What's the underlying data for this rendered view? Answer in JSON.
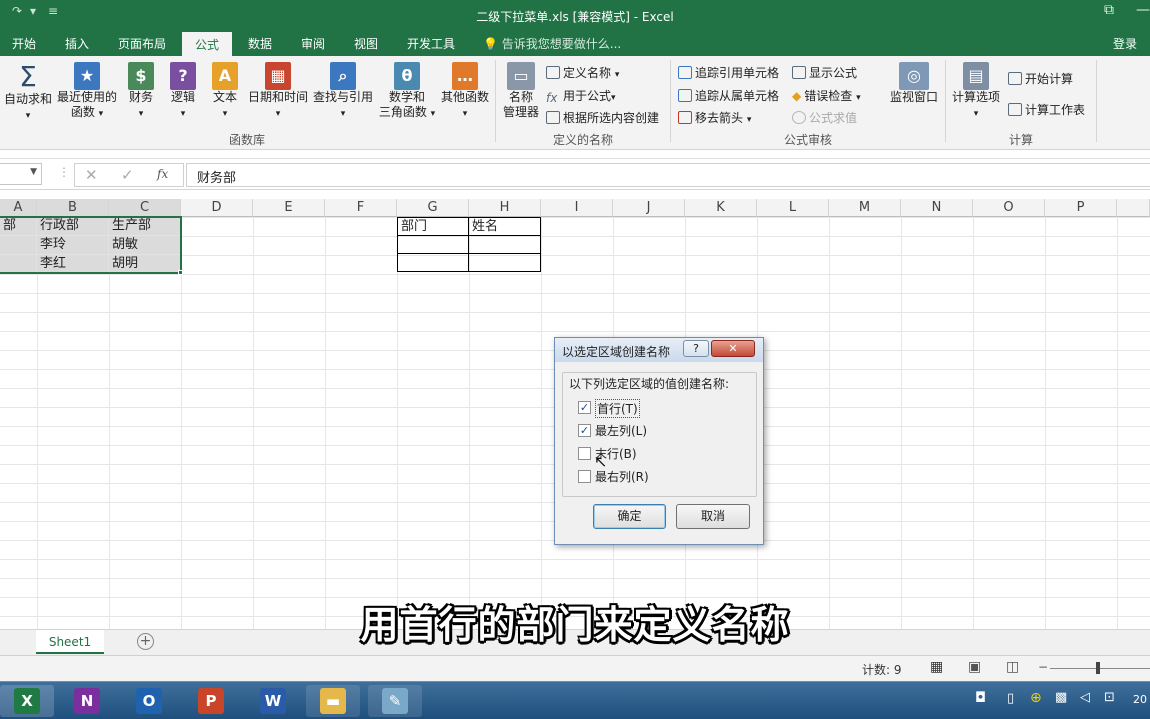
{
  "window": {
    "title": "二级下拉菜单.xls  [兼容模式] - Excel"
  },
  "tabs": [
    {
      "label": "开始"
    },
    {
      "label": "插入"
    },
    {
      "label": "页面布局"
    },
    {
      "label": "公式"
    },
    {
      "label": "数据"
    },
    {
      "label": "审阅"
    },
    {
      "label": "视图"
    },
    {
      "label": "开发工具"
    }
  ],
  "active_tab": "公式",
  "tell_me": "告诉我您想要做什么...",
  "user_login": "登录",
  "ribbon": {
    "function_library": {
      "group_label": "函数库",
      "buttons": [
        {
          "label": "自动求和"
        },
        {
          "label": "最近使用的",
          "label2": "函数"
        },
        {
          "label": "财务"
        },
        {
          "label": "逻辑"
        },
        {
          "label": "文本"
        },
        {
          "label": "日期和时间"
        },
        {
          "label": "查找与引用"
        },
        {
          "label": "数学和",
          "label2": "三角函数"
        },
        {
          "label": "其他函数"
        }
      ]
    },
    "defined_names": {
      "group_label": "定义的名称",
      "name_manager": {
        "label": "名称",
        "label2": "管理器"
      },
      "define_name": "定义名称",
      "use_in_formula": "用于公式",
      "create_from_selection": "根据所选内容创建"
    },
    "formula_auditing": {
      "group_label": "公式审核",
      "trace_precedents": "追踪引用单元格",
      "trace_dependents": "追踪从属单元格",
      "remove_arrows": "移去箭头",
      "show_formulas": "显示公式",
      "error_checking": "错误检查",
      "evaluate_formula": "公式求值",
      "watch_window": "监视窗口"
    },
    "calculation": {
      "group_label": "计算",
      "calc_options": "计算选项",
      "calc_now": "开始计算",
      "calc_sheet": "计算工作表"
    }
  },
  "formula_bar": {
    "fx": "fx",
    "value": "财务部"
  },
  "columns": [
    "A",
    "B",
    "C",
    "D",
    "E",
    "F",
    "G",
    "H",
    "I",
    "J",
    "K",
    "L",
    "M",
    "N",
    "O",
    "P"
  ],
  "cells": {
    "A1": "部",
    "B1": "行政部",
    "C1": "生产部",
    "B2": "李玲",
    "C2": "胡敏",
    "B3": "李红",
    "C3": "胡明",
    "G1": "部门",
    "H1": "姓名"
  },
  "sheet_tab": "Sheet1",
  "status": {
    "count": "计数: 9"
  },
  "dialog": {
    "title": "以选定区域创建名称",
    "help": "?",
    "group_label": "以下列选定区域的值创建名称:",
    "options": [
      {
        "label": "首行(T)",
        "checked": true
      },
      {
        "label": "最左列(L)",
        "checked": true
      },
      {
        "label": "末行(B)",
        "checked": false
      },
      {
        "label": "最右列(R)",
        "checked": false
      }
    ],
    "ok": "确定",
    "cancel": "取消"
  },
  "subtitle": "用首行的部门来定义名称",
  "taskbar_clock_partial": "20"
}
